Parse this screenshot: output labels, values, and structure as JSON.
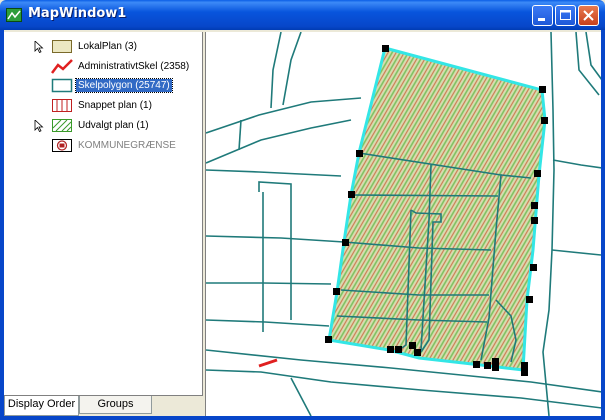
{
  "window": {
    "title": "MapWindow1",
    "controls": [
      "minimize",
      "maximize",
      "close"
    ]
  },
  "legend": {
    "layers": [
      {
        "label": "LokalPlan (3)",
        "icon": "polygon-symbol-icon",
        "cursor": true,
        "selected": false,
        "visible": true
      },
      {
        "label": "AdministrativtSkel (2358)",
        "icon": "line-symbol-icon",
        "cursor": false,
        "selected": false,
        "visible": true
      },
      {
        "label": "Skelpolygon (25747)",
        "icon": "polygon-symbol-icon",
        "cursor": false,
        "selected": true,
        "visible": true
      },
      {
        "label": "Snappet plan (1)",
        "icon": "hatched-polygon-icon",
        "cursor": false,
        "selected": false,
        "visible": true
      },
      {
        "label": "Udvalgt plan (1)",
        "icon": "diagonal-hatched-polygon-icon",
        "cursor": true,
        "selected": false,
        "visible": true
      },
      {
        "label": "KOMMUNEGRÆNSE",
        "icon": "image-layer-icon",
        "cursor": false,
        "selected": false,
        "visible": false
      }
    ]
  },
  "tabs": {
    "display_order": "Display Order",
    "groups": "Groups",
    "active": "display_order"
  },
  "colors": {
    "parcel_lines": "#1f7a7a",
    "selected_plan_outline": "#33e6e6",
    "hatch_green": "#77c060",
    "hatch_red": "#d06a4a",
    "admin_line": "#e02020",
    "vertex": "#000000",
    "selection_blue": "#316ac5"
  }
}
